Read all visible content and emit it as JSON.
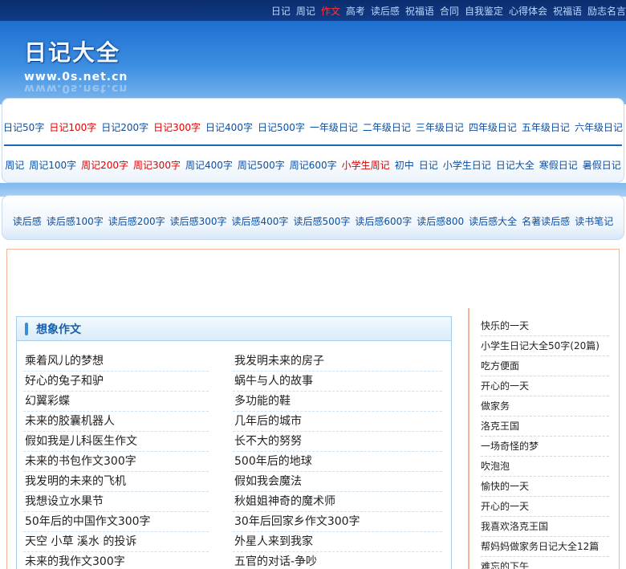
{
  "topnav": [
    {
      "label": "日记",
      "hot": false
    },
    {
      "label": "周记",
      "hot": false
    },
    {
      "label": "作文",
      "hot": true
    },
    {
      "label": "高考",
      "hot": false
    },
    {
      "label": "读后感",
      "hot": false
    },
    {
      "label": "祝福语",
      "hot": false
    },
    {
      "label": "合同",
      "hot": false
    },
    {
      "label": "自我鉴定",
      "hot": false
    },
    {
      "label": "心得体会",
      "hot": false
    },
    {
      "label": "祝福语",
      "hot": false
    },
    {
      "label": "励志名言",
      "hot": false
    }
  ],
  "logo": {
    "title": "日记大全",
    "url": "www.0s.net.cn"
  },
  "nav_row1": [
    {
      "label": "日记50字",
      "hot": false
    },
    {
      "label": "日记100字",
      "hot": true
    },
    {
      "label": "日记200字",
      "hot": false
    },
    {
      "label": "日记300字",
      "hot": true
    },
    {
      "label": "日记400字",
      "hot": false
    },
    {
      "label": "日记500字",
      "hot": false
    },
    {
      "label": "一年级日记",
      "hot": false
    },
    {
      "label": "二年级日记",
      "hot": false
    },
    {
      "label": "三年级日记",
      "hot": false
    },
    {
      "label": "四年级日记",
      "hot": false
    },
    {
      "label": "五年级日记",
      "hot": false
    },
    {
      "label": "六年级日记",
      "hot": false
    }
  ],
  "nav_row2": [
    {
      "label": "周记",
      "hot": false
    },
    {
      "label": "周记100字",
      "hot": false
    },
    {
      "label": "周记200字",
      "hot": true
    },
    {
      "label": "周记300字",
      "hot": true
    },
    {
      "label": "周记400字",
      "hot": false
    },
    {
      "label": "周记500字",
      "hot": false
    },
    {
      "label": "周记600字",
      "hot": false
    },
    {
      "label": "小学生周记",
      "hot": true
    },
    {
      "label": "初中",
      "hot": false
    },
    {
      "label": "日记",
      "hot": false
    },
    {
      "label": "小学生日记",
      "hot": false
    },
    {
      "label": "日记大全",
      "hot": false
    },
    {
      "label": "寒假日记",
      "hot": false
    },
    {
      "label": "暑假日记",
      "hot": false
    }
  ],
  "nav_row3": [
    {
      "label": "读后感",
      "hot": false
    },
    {
      "label": "读后感100字",
      "hot": false
    },
    {
      "label": "读后感200字",
      "hot": false
    },
    {
      "label": "读后感300字",
      "hot": false
    },
    {
      "label": "读后感400字",
      "hot": false
    },
    {
      "label": "读后感500字",
      "hot": false
    },
    {
      "label": "读后感600字",
      "hot": false
    },
    {
      "label": "读后感800",
      "hot": false
    },
    {
      "label": "读后感大全",
      "hot": false
    },
    {
      "label": "名著读后感",
      "hot": false
    },
    {
      "label": "读书笔记",
      "hot": false
    }
  ],
  "section": {
    "title": "想象作文",
    "items": [
      "乘着风儿的梦想",
      "我发明未来的房子",
      "好心的兔子和驴",
      "蜗牛与人的故事",
      "幻翼彩蝶",
      "多功能的鞋",
      "未来的胶囊机器人",
      "几年后的城市",
      "假如我是儿科医生作文",
      "长不大的努努",
      "未来的书包作文300字",
      "500年后的地球",
      "我发明的未来的飞机",
      "假如我会魔法",
      "我想设立水果节",
      "秋姐姐神奇的魔术师",
      "50年后的中国作文300字",
      "30年后回家乡作文300字",
      "天空 小草 溪水 的投诉",
      "外星人来到我家",
      "未来的我作文300字",
      "五官的对话-争吵"
    ]
  },
  "sidebar": {
    "items": [
      "快乐的一天",
      "小学生日记大全50字(20篇)",
      "吃方便面",
      "开心的一天",
      "做家务",
      "洛克王国",
      "一场奇怪的梦",
      "吹泡泡",
      "愉快的一天",
      "开心的一天",
      "我喜欢洛克王国",
      "帮妈妈做家务日记大全12篇",
      "难忘的下午"
    ]
  },
  "colors": {
    "link_blue": "#0b4fa3",
    "hot_red": "#e00000",
    "header_blue": "#1f6fd0"
  }
}
